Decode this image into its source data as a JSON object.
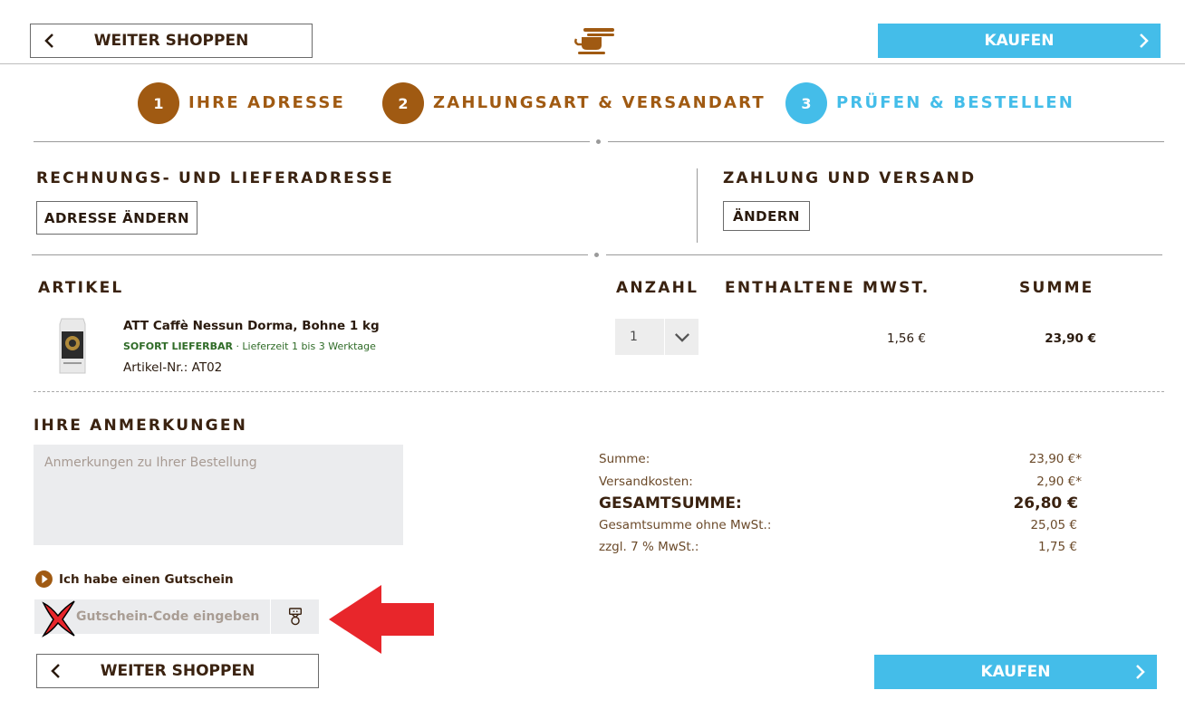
{
  "header": {
    "continue_label": "WEITER SHOPPEN",
    "buy_label": "KAUFEN",
    "logo_icon": "coffee-cup-icon"
  },
  "steps": [
    {
      "number": "1",
      "label": "IHRE ADRESSE",
      "color": "#a05a12"
    },
    {
      "number": "2",
      "label": "ZAHLUNGSART & VERSANDART",
      "color": "#a05a12"
    },
    {
      "number": "3",
      "label": "PRÜFEN & BESTELLEN",
      "color": "#44bde9"
    }
  ],
  "address": {
    "title": "RECHNUNGS- UND LIEFERADRESSE",
    "button": "ADRESSE ÄNDERN"
  },
  "payment": {
    "title": "ZAHLUNG UND VERSAND",
    "button": "ÄNDERN"
  },
  "table": {
    "headers": {
      "article": "ARTIKEL",
      "qty": "ANZAHL",
      "vat": "ENTHALTENE MWST.",
      "sum": "SUMME"
    },
    "items": [
      {
        "name": "ATT Caffè Nessun Dorma, Bohne 1 kg",
        "availability": "SOFORT LIEFERBAR",
        "delivery": "· Lieferzeit 1 bis 3 Werktage",
        "artnr": "Artikel-Nr.: AT02",
        "qty": "1",
        "vat": "1,56 €",
        "sum": "23,90 €"
      }
    ]
  },
  "notes": {
    "title": "IHRE ANMERKUNGEN",
    "placeholder": "Anmerkungen zu Ihrer Bestellung"
  },
  "coupon": {
    "link": "Ich habe einen Gutschein",
    "placeholder": "Gutschein-Code eingeben"
  },
  "totals": {
    "subtotal_label": "Summe:",
    "subtotal": "23,90 €*",
    "shipping_label": "Versandkosten:",
    "shipping": "2,90 €*",
    "grand_label": "GESAMTSUMME:",
    "grand": "26,80 €",
    "net_label": "Gesamtsumme ohne MwSt.:",
    "net": "25,05 €",
    "vat_label": "zzgl. 7 % MwSt.:",
    "vat": "1,75 €"
  },
  "footer": {
    "continue_label": "WEITER SHOPPEN",
    "buy_label": "KAUFEN"
  },
  "colors": {
    "brown": "#a05a12",
    "blue": "#44bde9",
    "arrow_red": "#e8262b"
  }
}
